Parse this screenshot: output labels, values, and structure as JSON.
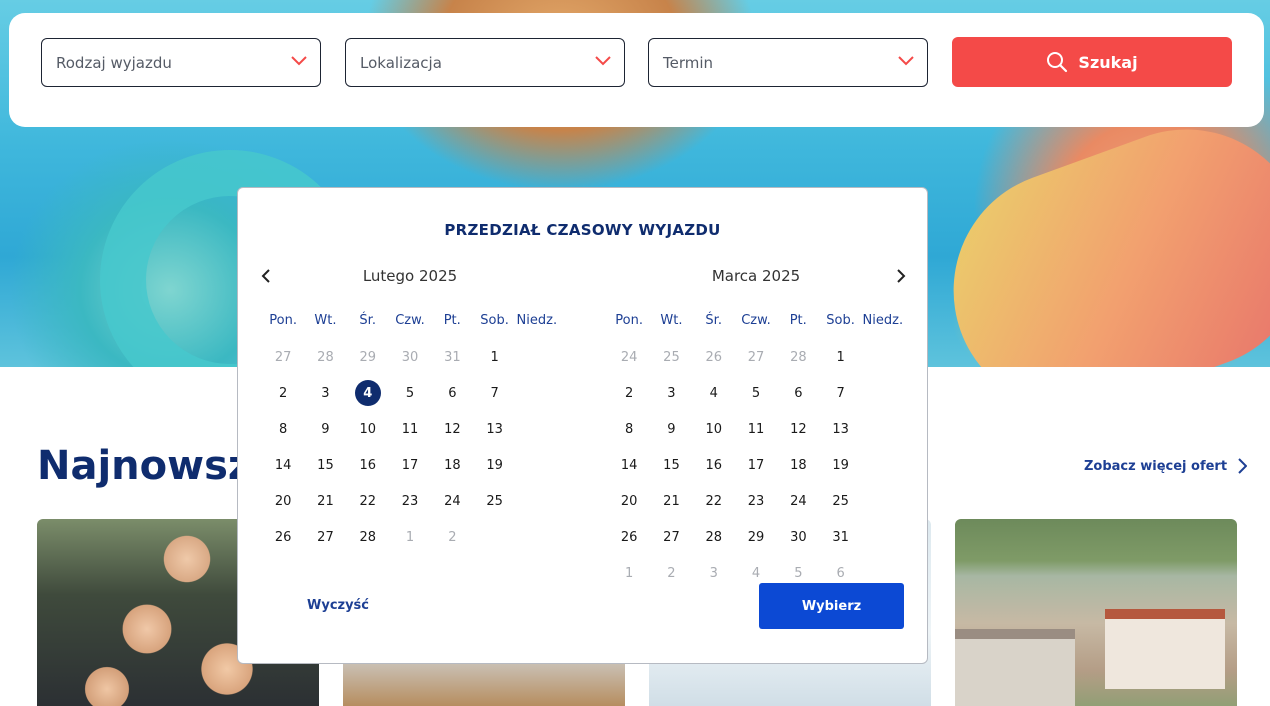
{
  "search": {
    "trip_type_placeholder": "Rodzaj wyjazdu",
    "location_placeholder": "Lokalizacja",
    "date_placeholder": "Termin",
    "search_button": "Szukaj"
  },
  "section": {
    "title": "Najnowsze",
    "more_link": "Zobacz więcej ofert"
  },
  "calendar": {
    "title": "PRZEDZIAŁ CZASOWY WYJAZDU",
    "weekdays": [
      "Pon.",
      "Wt.",
      "Śr.",
      "Czw.",
      "Pt.",
      "Sob.",
      "Niedz."
    ],
    "months": [
      {
        "label": "Lutego 2025",
        "days": [
          {
            "d": "27",
            "muted": true
          },
          {
            "d": "28",
            "muted": true
          },
          {
            "d": "29",
            "muted": true
          },
          {
            "d": "30",
            "muted": true
          },
          {
            "d": "31",
            "muted": true
          },
          {
            "d": "1"
          },
          {
            "d": "2"
          },
          {
            "d": "3"
          },
          {
            "d": "4",
            "selected": true
          },
          {
            "d": "5"
          },
          {
            "d": "6"
          },
          {
            "d": "7"
          },
          {
            "d": "8"
          },
          {
            "d": "9"
          },
          {
            "d": "10"
          },
          {
            "d": "11"
          },
          {
            "d": "12"
          },
          {
            "d": "13"
          },
          {
            "d": "14"
          },
          {
            "d": "15"
          },
          {
            "d": "16"
          },
          {
            "d": "17"
          },
          {
            "d": "18"
          },
          {
            "d": "19"
          },
          {
            "d": "20"
          },
          {
            "d": "21"
          },
          {
            "d": "22"
          },
          {
            "d": "23"
          },
          {
            "d": "24"
          },
          {
            "d": "25"
          },
          {
            "d": "26"
          },
          {
            "d": "27"
          },
          {
            "d": "28"
          },
          {
            "d": "1",
            "muted": true
          },
          {
            "d": "2",
            "muted": true
          }
        ]
      },
      {
        "label": "Marca 2025",
        "days": [
          {
            "d": "24",
            "muted": true
          },
          {
            "d": "25",
            "muted": true
          },
          {
            "d": "26",
            "muted": true
          },
          {
            "d": "27",
            "muted": true
          },
          {
            "d": "28",
            "muted": true
          },
          {
            "d": "1"
          },
          {
            "d": "2"
          },
          {
            "d": "3"
          },
          {
            "d": "4"
          },
          {
            "d": "5"
          },
          {
            "d": "6"
          },
          {
            "d": "7"
          },
          {
            "d": "8"
          },
          {
            "d": "9"
          },
          {
            "d": "10"
          },
          {
            "d": "11"
          },
          {
            "d": "12"
          },
          {
            "d": "13"
          },
          {
            "d": "14"
          },
          {
            "d": "15"
          },
          {
            "d": "16"
          },
          {
            "d": "17"
          },
          {
            "d": "18"
          },
          {
            "d": "19"
          },
          {
            "d": "20"
          },
          {
            "d": "21"
          },
          {
            "d": "22"
          },
          {
            "d": "23"
          },
          {
            "d": "24"
          },
          {
            "d": "25"
          },
          {
            "d": "26"
          },
          {
            "d": "27"
          },
          {
            "d": "28"
          },
          {
            "d": "29"
          },
          {
            "d": "30"
          },
          {
            "d": "31"
          },
          {
            "d": "1",
            "muted": true
          },
          {
            "d": "2",
            "muted": true
          },
          {
            "d": "3",
            "muted": true
          },
          {
            "d": "4",
            "muted": true
          },
          {
            "d": "5",
            "muted": true
          },
          {
            "d": "6",
            "muted": true
          }
        ]
      }
    ],
    "clear_button": "Wyczyść",
    "choose_button": "Wybierz"
  },
  "colors": {
    "brand_navy": "#0f2c6e",
    "search_red": "#f44a48",
    "choose_blue": "#0c49d4"
  },
  "icons": [
    "chevron-down-icon",
    "search-icon",
    "chevron-left-icon",
    "chevron-right-icon"
  ]
}
